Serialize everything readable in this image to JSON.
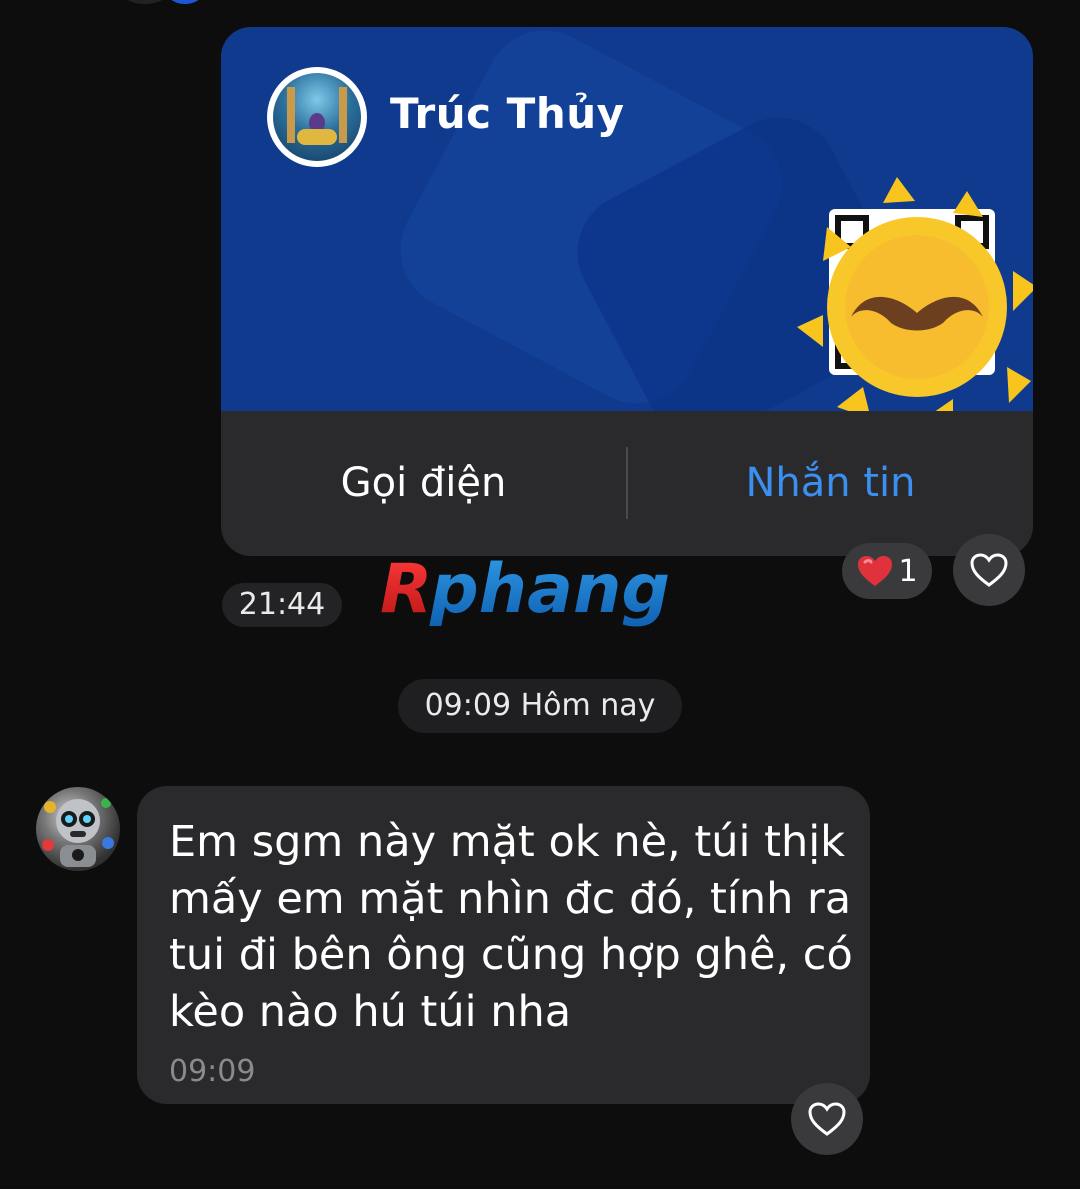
{
  "contact_card": {
    "name": "Trúc Thủy",
    "call_label": "Gọi điện",
    "message_label": "Nhắn tin",
    "message_color": "#3a8ff0",
    "banner_color": "#0f3a8e",
    "time": "21:44",
    "reaction": {
      "emoji": "heart",
      "count": "1"
    }
  },
  "watermark": {
    "text": "Rphang"
  },
  "date_separator": "09:09 Hôm nay",
  "message": {
    "text": "Em sgm này mặt ok nè, túi thịk mấy em mặt nhìn đc đó, tính ra tui đi bên ông cũng hợp ghê, có kèo nào hú túi nha",
    "time": "09:09"
  },
  "colors": {
    "background": "#0d0d0d",
    "bubble": "#2a2a2c",
    "accent": "#3a8ff0"
  }
}
